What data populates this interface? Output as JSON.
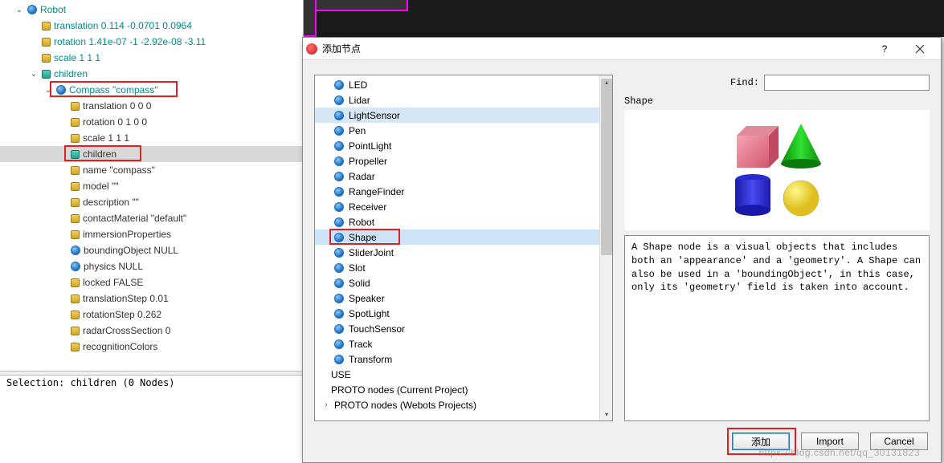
{
  "scene_tree": {
    "root": "Robot",
    "items": [
      {
        "indent": 1,
        "icon": "sphere",
        "label": "Robot",
        "expand": "open",
        "class": "robot"
      },
      {
        "indent": 2,
        "icon": "field",
        "label": "translation 0.114 -0.0701 0.0964",
        "class": "field-val"
      },
      {
        "indent": 2,
        "icon": "field",
        "label": "rotation 1.41e-07 -1 -2.92e-08 -3.11",
        "class": "field-val"
      },
      {
        "indent": 2,
        "icon": "field",
        "label": "scale 1 1 1",
        "class": "field-val"
      },
      {
        "indent": 2,
        "icon": "field-teal",
        "label": "children",
        "expand": "open",
        "class": "field-val"
      },
      {
        "indent": 3,
        "icon": "sphere",
        "label": "Compass \"compass\"",
        "expand": "open",
        "class": "robot",
        "box": true
      },
      {
        "indent": 4,
        "icon": "field",
        "label": "translation 0 0 0"
      },
      {
        "indent": 4,
        "icon": "field",
        "label": "rotation 0 1 0 0"
      },
      {
        "indent": 4,
        "icon": "field",
        "label": "scale 1 1 1"
      },
      {
        "indent": 4,
        "icon": "field-teal",
        "label": "children",
        "selected": true,
        "box": true
      },
      {
        "indent": 4,
        "icon": "field",
        "label": "name \"compass\""
      },
      {
        "indent": 4,
        "icon": "field",
        "label": "model \"\""
      },
      {
        "indent": 4,
        "icon": "field",
        "label": "description \"\""
      },
      {
        "indent": 4,
        "icon": "field",
        "label": "contactMaterial \"default\""
      },
      {
        "indent": 4,
        "icon": "field",
        "label": "immersionProperties"
      },
      {
        "indent": 4,
        "icon": "sphere",
        "label": "boundingObject NULL"
      },
      {
        "indent": 4,
        "icon": "sphere",
        "label": "physics NULL"
      },
      {
        "indent": 4,
        "icon": "field",
        "label": "locked FALSE"
      },
      {
        "indent": 4,
        "icon": "field",
        "label": "translationStep 0.01"
      },
      {
        "indent": 4,
        "icon": "field",
        "label": "rotationStep 0.262"
      },
      {
        "indent": 4,
        "icon": "field",
        "label": "radarCrossSection 0"
      },
      {
        "indent": 4,
        "icon": "field",
        "label": "recognitionColors"
      }
    ],
    "selection_text": "Selection: children (0 Nodes)"
  },
  "dialog": {
    "title": "添加节点",
    "find_label": "Find:",
    "find_value": "",
    "shape_heading": "Shape",
    "description": "A Shape node is a visual objects that includes both an 'appearance' and a 'geometry'. A Shape can also be used in a 'boundingObject', in this case, only its 'geometry' field is taken into account.",
    "nodes": [
      {
        "label": "LED"
      },
      {
        "label": "Lidar"
      },
      {
        "label": "LightSensor",
        "hl": true
      },
      {
        "label": "Pen"
      },
      {
        "label": "PointLight"
      },
      {
        "label": "Propeller"
      },
      {
        "label": "Radar"
      },
      {
        "label": "RangeFinder"
      },
      {
        "label": "Receiver"
      },
      {
        "label": "Robot"
      },
      {
        "label": "Shape",
        "sel": true,
        "box": true
      },
      {
        "label": "SliderJoint"
      },
      {
        "label": "Slot"
      },
      {
        "label": "Solid"
      },
      {
        "label": "Speaker"
      },
      {
        "label": "SpotLight"
      },
      {
        "label": "TouchSensor"
      },
      {
        "label": "Track"
      },
      {
        "label": "Transform"
      }
    ],
    "sections": [
      {
        "label": "USE"
      },
      {
        "label": "PROTO nodes (Current Project)"
      },
      {
        "label": "PROTO nodes (Webots Projects)",
        "expand": "closed"
      }
    ],
    "buttons": {
      "add": "添加",
      "import": "Import",
      "cancel": "Cancel"
    }
  },
  "watermark": "https://blog.csdn.net/qq_30131823"
}
